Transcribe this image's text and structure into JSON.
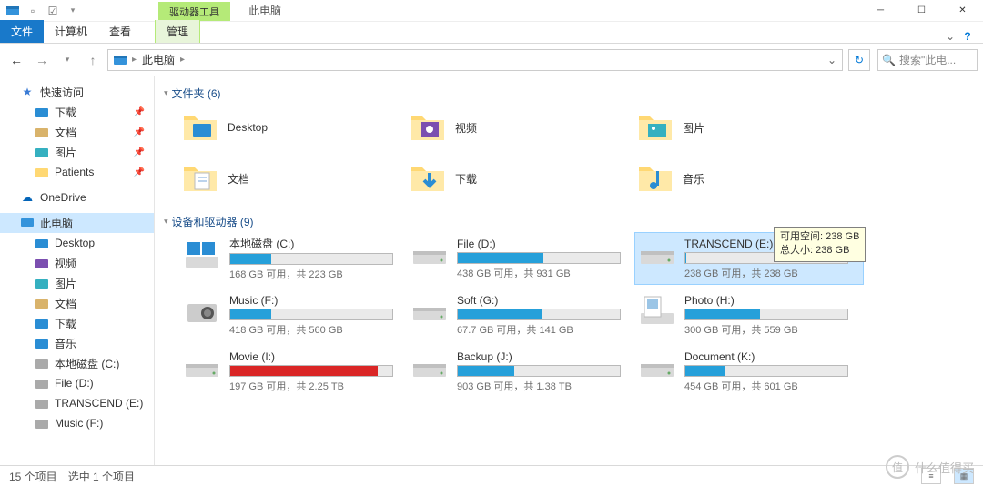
{
  "titlebar": {
    "context_tab": "驱动器工具",
    "title": "此电脑"
  },
  "ribbon": {
    "tabs": [
      "文件",
      "计算机",
      "查看"
    ],
    "context_tab": "管理"
  },
  "nav": {
    "breadcrumb_root": "此电脑",
    "search_placeholder": "搜索\"此电..."
  },
  "navpane": {
    "quick_access": "快速访问",
    "quick_items": [
      {
        "label": "下载",
        "pin": true
      },
      {
        "label": "文档",
        "pin": true
      },
      {
        "label": "图片",
        "pin": true
      },
      {
        "label": "Patients",
        "pin": true
      }
    ],
    "onedrive": "OneDrive",
    "this_pc": "此电脑",
    "pc_items": [
      {
        "label": "Desktop"
      },
      {
        "label": "视频"
      },
      {
        "label": "图片"
      },
      {
        "label": "文档"
      },
      {
        "label": "下载"
      },
      {
        "label": "音乐"
      },
      {
        "label": "本地磁盘 (C:)"
      },
      {
        "label": "File (D:)"
      },
      {
        "label": "TRANSCEND (E:)"
      },
      {
        "label": "Music (F:)"
      }
    ]
  },
  "groups": {
    "folders_header": "文件夹 (6)",
    "drives_header": "设备和驱动器 (9)"
  },
  "folders": [
    {
      "label": "Desktop",
      "icon": "desktop"
    },
    {
      "label": "视频",
      "icon": "video"
    },
    {
      "label": "图片",
      "icon": "pictures"
    },
    {
      "label": "文档",
      "icon": "docs"
    },
    {
      "label": "下载",
      "icon": "downloads"
    },
    {
      "label": "音乐",
      "icon": "music"
    }
  ],
  "drives": [
    {
      "name": "本地磁盘 (C:)",
      "stat": "168 GB 可用，共 223 GB",
      "pct": 25,
      "icon": "osdrive"
    },
    {
      "name": "File (D:)",
      "stat": "438 GB 可用，共 931 GB",
      "pct": 53,
      "icon": "drive"
    },
    {
      "name": "TRANSCEND (E:)",
      "stat": "238 GB 可用，共 238 GB",
      "pct": 0.5,
      "icon": "drive",
      "sel": true
    },
    {
      "name": "Music (F:)",
      "stat": "418 GB 可用，共 560 GB",
      "pct": 25,
      "icon": "camera"
    },
    {
      "name": "Soft (G:)",
      "stat": "67.7 GB 可用，共 141 GB",
      "pct": 52,
      "icon": "drive"
    },
    {
      "name": "Photo (H:)",
      "stat": "300 GB 可用，共 559 GB",
      "pct": 46,
      "icon": "photodrive"
    },
    {
      "name": "Movie (I:)",
      "stat": "197 GB 可用，共 2.25 TB",
      "pct": 91,
      "icon": "drive",
      "red": true
    },
    {
      "name": "Backup (J:)",
      "stat": "903 GB 可用，共 1.38 TB",
      "pct": 35,
      "icon": "drive"
    },
    {
      "name": "Document (K:)",
      "stat": "454 GB 可用，共 601 GB",
      "pct": 24,
      "icon": "drive"
    }
  ],
  "tooltip": {
    "line1": "可用空间: 238 GB",
    "line2": "总大小: 238 GB"
  },
  "statusbar": {
    "count": "15 个项目",
    "selected": "选中 1 个项目"
  },
  "watermark": "什么值得买"
}
